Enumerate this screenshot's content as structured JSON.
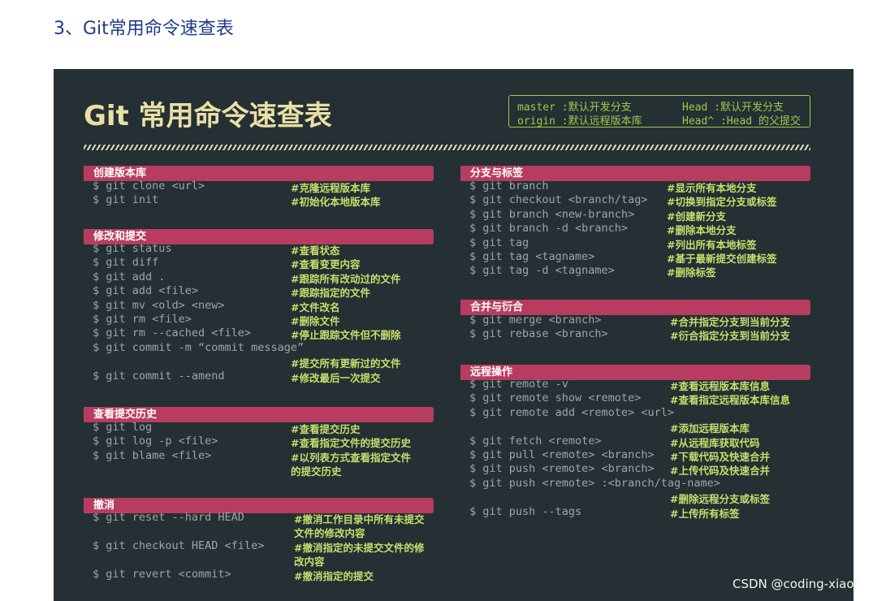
{
  "page_heading": "3、Git常用命令速查表",
  "sheet": {
    "title": "Git 常用命令速查表",
    "legend": [
      [
        "master :默认开发分支",
        "Head  :默认开发分支"
      ],
      [
        "origin :默认远程版本库",
        "Head^ :Head 的父提交"
      ]
    ],
    "sections": [
      {
        "title": "创建版本库",
        "rows": [
          {
            "cmd": "$ git clone <url>",
            "comment": "#克隆远程版本库"
          },
          {
            "cmd": "$ git init",
            "comment": "#初始化本地版本库"
          }
        ]
      },
      {
        "title": "修改和提交",
        "rows": [
          {
            "cmd": "$ git status",
            "comment": "#查看状态"
          },
          {
            "cmd": "$ git diff",
            "comment": "#查看变更内容"
          },
          {
            "cmd": "$ git add .",
            "comment": "#跟踪所有改动过的文件"
          },
          {
            "cmd": "$ git add <file>",
            "comment": "#跟踪指定的文件"
          },
          {
            "cmd": "$ git mv <old> <new>",
            "comment": "#文件改名"
          },
          {
            "cmd": "$ git rm <file>",
            "comment": "#删除文件"
          },
          {
            "cmd": "$ git rm --cached <file>",
            "comment": "#停止跟踪文件但不删除"
          },
          {
            "cmd": "$ git commit -m “commit message”",
            "comment": ""
          },
          {
            "cmd": "",
            "comment": "#提交所有更新过的文件"
          },
          {
            "cmd": "$ git commit --amend",
            "comment": "#修改最后一次提交"
          }
        ]
      },
      {
        "title": "查看提交历史",
        "rows": [
          {
            "cmd": "$ git log",
            "comment": "#查看提交历史"
          },
          {
            "cmd": "$ git log -p <file>",
            "comment": "#查看指定文件的提交历史"
          },
          {
            "cmd": "$ git blame <file>",
            "comment": "#以列表方式查看指定文件"
          },
          {
            "cmd": "",
            "comment": "的提交历史"
          }
        ]
      },
      {
        "title": "撤消",
        "rows": [
          {
            "cmd": "$ git reset --hard HEAD",
            "comment": "#撤消工作目录中所有未提交"
          },
          {
            "cmd": "",
            "comment": "文件的修改内容"
          },
          {
            "cmd": "$ git checkout HEAD <file>",
            "comment": "#撤消指定的未提交文件的修"
          },
          {
            "cmd": "",
            "comment": "改内容"
          },
          {
            "cmd": "$ git revert <commit>",
            "comment": "#撤消指定的提交"
          }
        ]
      },
      {
        "title": "分支与标签",
        "rows": [
          {
            "cmd": "$ git branch",
            "comment": "#显示所有本地分支"
          },
          {
            "cmd": "$ git checkout <branch/tag>",
            "comment": "#切换到指定分支或标签"
          },
          {
            "cmd": "$ git branch <new-branch>",
            "comment": "#创建新分支"
          },
          {
            "cmd": "$ git branch -d <branch>",
            "comment": "#删除本地分支"
          },
          {
            "cmd": "$ git tag",
            "comment": "#列出所有本地标签"
          },
          {
            "cmd": "$ git tag <tagname>",
            "comment": "#基于最新提交创建标签"
          },
          {
            "cmd": "$ git tag -d <tagname>",
            "comment": "#删除标签"
          }
        ]
      },
      {
        "title": "合并与衍合",
        "rows": [
          {
            "cmd": "$ git merge <branch>",
            "comment": "#合并指定分支到当前分支"
          },
          {
            "cmd": "$ git rebase <branch>",
            "comment": "#衍合指定分支到当前分支"
          }
        ]
      },
      {
        "title": "远程操作",
        "rows": [
          {
            "cmd": "$ git remote -v",
            "comment": "#查看远程版本库信息"
          },
          {
            "cmd": "$ git remote show <remote>",
            "comment": "#查看指定远程版本库信息"
          },
          {
            "cmd": "$ git remote add <remote> <url>",
            "comment": ""
          },
          {
            "cmd": "",
            "comment": "#添加远程版本库"
          },
          {
            "cmd": "$ git fetch <remote>",
            "comment": "#从远程库获取代码"
          },
          {
            "cmd": "$ git pull <remote> <branch>",
            "comment": "#下载代码及快速合并"
          },
          {
            "cmd": "$ git push <remote> <branch>",
            "comment": "#上传代码及快速合并"
          },
          {
            "cmd": "$ git push <remote> :<branch/tag-name>",
            "comment": ""
          },
          {
            "cmd": "",
            "comment": "#删除远程分支或标签"
          },
          {
            "cmd": "$ git push --tags",
            "comment": "#上传所有标签"
          }
        ]
      }
    ]
  },
  "watermark": "CSDN @coding-xiaoli",
  "colors": {
    "background": "#243033",
    "section_header": "#b83c60",
    "command_text": "#9aa7a8",
    "comment_text": "#c8de6d",
    "title_text": "#e9dfa7",
    "legend_text": "#9ccb4e"
  }
}
